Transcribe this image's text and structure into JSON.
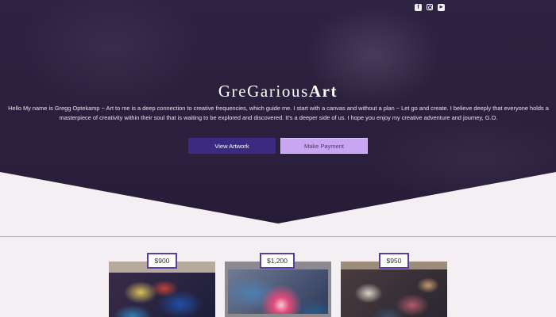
{
  "social": {
    "icons": [
      "facebook-icon",
      "instagram-icon",
      "youtube-icon"
    ],
    "facebook": "f",
    "youtube": "▶"
  },
  "brand": {
    "title_light": "GreGarious",
    "title_bold": "Art"
  },
  "intro": "Hello My name is Gregg Optekamp ~ Art to me is a deep connection to creative frequencies, which guide me. I start with a canvas and without a plan ~ Let go and create. I believe deeply that everyone holds a masterpiece of creativity within their soul that is waiting to be explored and discovered. It's a deeper side of us. I hope you enjoy my creative adventure and journey, G.O.",
  "buttons": {
    "view": "View Artwork",
    "pay": "Make Payment"
  },
  "colors": {
    "hero": "#2b203e",
    "view_button": "#3a2a82",
    "pay_button": "#c9a6f2",
    "price_border": "#5a3ea0"
  },
  "artworks": [
    {
      "price": "$900"
    },
    {
      "price": "$1,200"
    },
    {
      "price": "$950"
    }
  ]
}
